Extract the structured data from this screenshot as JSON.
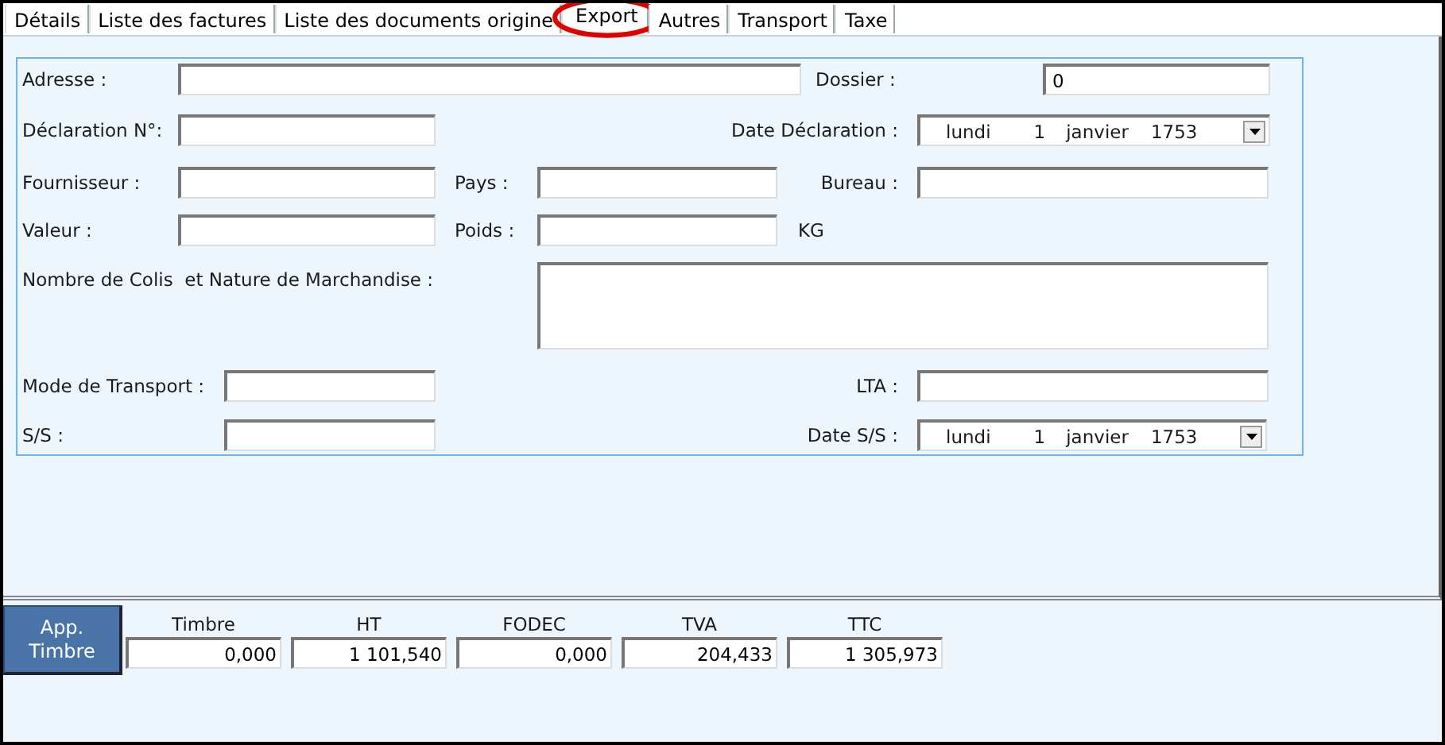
{
  "tabs": [
    {
      "label": "Détails",
      "selected": false
    },
    {
      "label": "Liste des factures",
      "selected": false
    },
    {
      "label": "Liste des documents origine",
      "selected": false
    },
    {
      "label": "Export",
      "selected": true,
      "circled": true
    },
    {
      "label": "Autres",
      "selected": false
    },
    {
      "label": "Transport",
      "selected": false
    },
    {
      "label": "Taxe",
      "selected": false
    }
  ],
  "form": {
    "fields": [
      {
        "kind": "text",
        "label": "Adresse :"
      },
      {
        "kind": "text",
        "label": "Dossier :",
        "value": "0"
      },
      {
        "kind": "text",
        "label": "Déclaration N°:"
      },
      {
        "kind": "date",
        "label": "Date Déclaration :",
        "date": {
          "weekday": "lundi",
          "day": "1",
          "month": "janvier",
          "year": "1753"
        }
      },
      {
        "kind": "text",
        "label": "Fournisseur :"
      },
      {
        "kind": "text",
        "label": "Pays :"
      },
      {
        "kind": "text",
        "label": "Bureau :"
      },
      {
        "kind": "text",
        "label": "Valeur :"
      },
      {
        "kind": "text",
        "label": "Poids :",
        "unit": "KG"
      },
      {
        "kind": "textarea",
        "label": "Nombre de Colis  et Nature de Marchandise :"
      },
      {
        "kind": "text",
        "label": "Mode de Transport :"
      },
      {
        "kind": "text",
        "label": "LTA :"
      },
      {
        "kind": "text",
        "label": "S/S :"
      },
      {
        "kind": "date",
        "label": "Date S/S :",
        "date": {
          "weekday": "lundi",
          "day": "1",
          "month": "janvier",
          "year": "1753"
        }
      }
    ]
  },
  "footer": {
    "button": "App.\nTimbre",
    "totals": [
      {
        "label": "Timbre",
        "value": "0,000"
      },
      {
        "label": "HT",
        "value": "1 101,540"
      },
      {
        "label": "FODEC",
        "value": "0,000"
      },
      {
        "label": "TVA",
        "value": "204,433"
      },
      {
        "label": "TTC",
        "value": "1 305,973"
      }
    ]
  }
}
